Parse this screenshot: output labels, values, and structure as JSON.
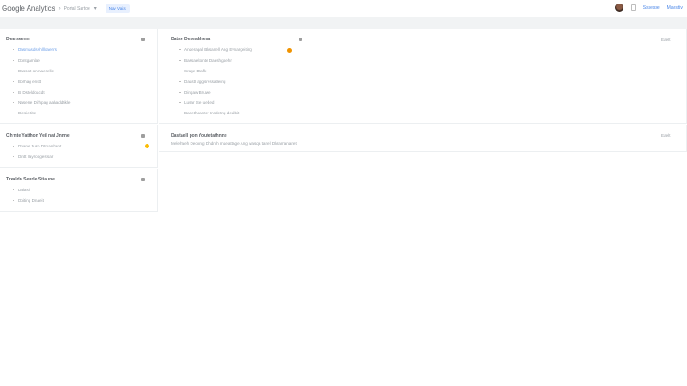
{
  "header": {
    "logo": "Google Analytics",
    "crumb": "Portal Sartoe",
    "pill": "Nav Vaits",
    "link_1": "Sssesse",
    "link_2": "Maestivl"
  },
  "cards_left": [
    {
      "title": "Dearseenn",
      "items": [
        "Dasmasdsehllloaerns",
        "Dontgamlae",
        "Dassoit onmaeselle",
        "Borhag enstt",
        "Bi Dsteldoacdt",
        "Naserre Dirhpag aahaddtikle",
        "Diesie tite"
      ],
      "active_index": 0
    },
    {
      "title": "Chrnte Yatthon Yeil nat Jnnne",
      "items": [
        "Dnane Jusn Dtmanhant",
        "Dintt llayropgestsar"
      ]
    },
    {
      "title": "Trealdn Senrle Stiaune",
      "items": [
        "Daiasi",
        "Doiting Dnaeit"
      ]
    }
  ],
  "cards_right": [
    {
      "title": "Datse Deseahhesa",
      "items": [
        "Anderapal Bhsanell Ang Evnargeiting",
        "Bassaeltonte Daeshgaehr",
        "Srage Brafk",
        "Daastl aggsressatleing",
        "Dingaw Bruwe",
        "Lusar Sle ueded",
        "Banetheanter Insdetng dealbit"
      ],
      "edit": "Eaelt"
    },
    {
      "title": "Dastaell pon Youtetathnne",
      "text": "Melehaeh Deoung Dhdnth maeattage Ang wasqa tanel Dhramananet",
      "edit": "Eaelt"
    }
  ],
  "colors": {
    "accent": "#4a86e8",
    "orange_dot": "#f09300",
    "yellow_dot": "#fbbc04",
    "band": "#f1f3f4"
  },
  "icons": [
    "settings-icon",
    "avatar",
    "apps-icon"
  ]
}
